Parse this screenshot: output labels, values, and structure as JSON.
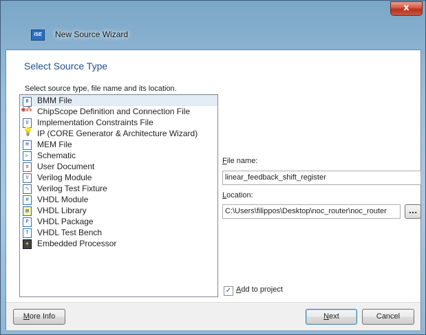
{
  "window": {
    "title": "New Source Wizard",
    "app_icon": "ise-logo-icon",
    "close_label": "x"
  },
  "heading": "Select Source Type",
  "instruction": "Select source type, file name and its location.",
  "source_types": [
    {
      "label": "BMM File",
      "icon": "file-bmm-icon",
      "selected": true
    },
    {
      "label": "ChipScope Definition and Connection File",
      "icon": "chipscope-icon"
    },
    {
      "label": "Implementation Constraints File",
      "icon": "file-constraints-icon"
    },
    {
      "label": "IP (CORE Generator & Architecture Wizard)",
      "icon": "ip-bulb-icon"
    },
    {
      "label": "MEM File",
      "icon": "file-mem-icon"
    },
    {
      "label": "Schematic",
      "icon": "file-schematic-icon"
    },
    {
      "label": "User Document",
      "icon": "file-document-icon"
    },
    {
      "label": "Verilog Module",
      "icon": "file-verilog-icon"
    },
    {
      "label": "Verilog Test Fixture",
      "icon": "file-verilog-test-icon"
    },
    {
      "label": "VHDL Module",
      "icon": "file-vhdl-icon"
    },
    {
      "label": "VHDL Library",
      "icon": "file-vhdl-library-icon"
    },
    {
      "label": "VHDL Package",
      "icon": "file-vhdl-package-icon"
    },
    {
      "label": "VHDL Test Bench",
      "icon": "file-vhdl-testbench-icon"
    },
    {
      "label": "Embedded Processor",
      "icon": "embedded-processor-icon"
    }
  ],
  "file_name": {
    "label_u": "F",
    "label_rest": "ile name:",
    "value": "linear_feedback_shift_register"
  },
  "location": {
    "label_u": "L",
    "label_rest": "ocation:",
    "value": "C:\\Users\\filippos\\Desktop\\noc_router\\noc_router"
  },
  "browse_label": "...",
  "add_to_project": {
    "checked": true,
    "mark": "✓",
    "label_u": "A",
    "label_rest": "dd to project"
  },
  "buttons": {
    "more_info_u": "M",
    "more_info_rest": "ore Info",
    "next_u": "N",
    "next_rest": "ext",
    "cancel": "Cancel"
  },
  "colors": {
    "heading": "#1f4e8c",
    "selected_row": "#e4ecf5",
    "close_button": "#c9563e"
  }
}
